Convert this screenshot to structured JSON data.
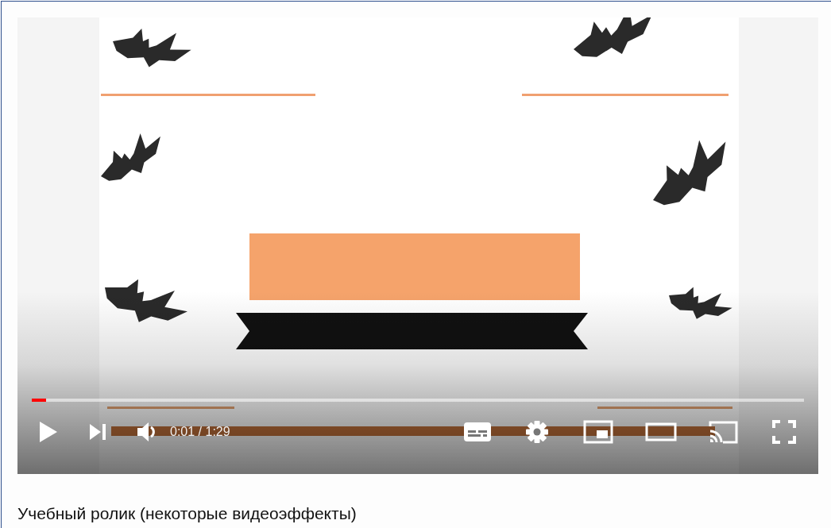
{
  "player": {
    "progress": {
      "level": 0.019
    },
    "time": "0:01 / 1:29"
  },
  "caption": "Учебный ролик (некоторые видеоэффекты)"
}
